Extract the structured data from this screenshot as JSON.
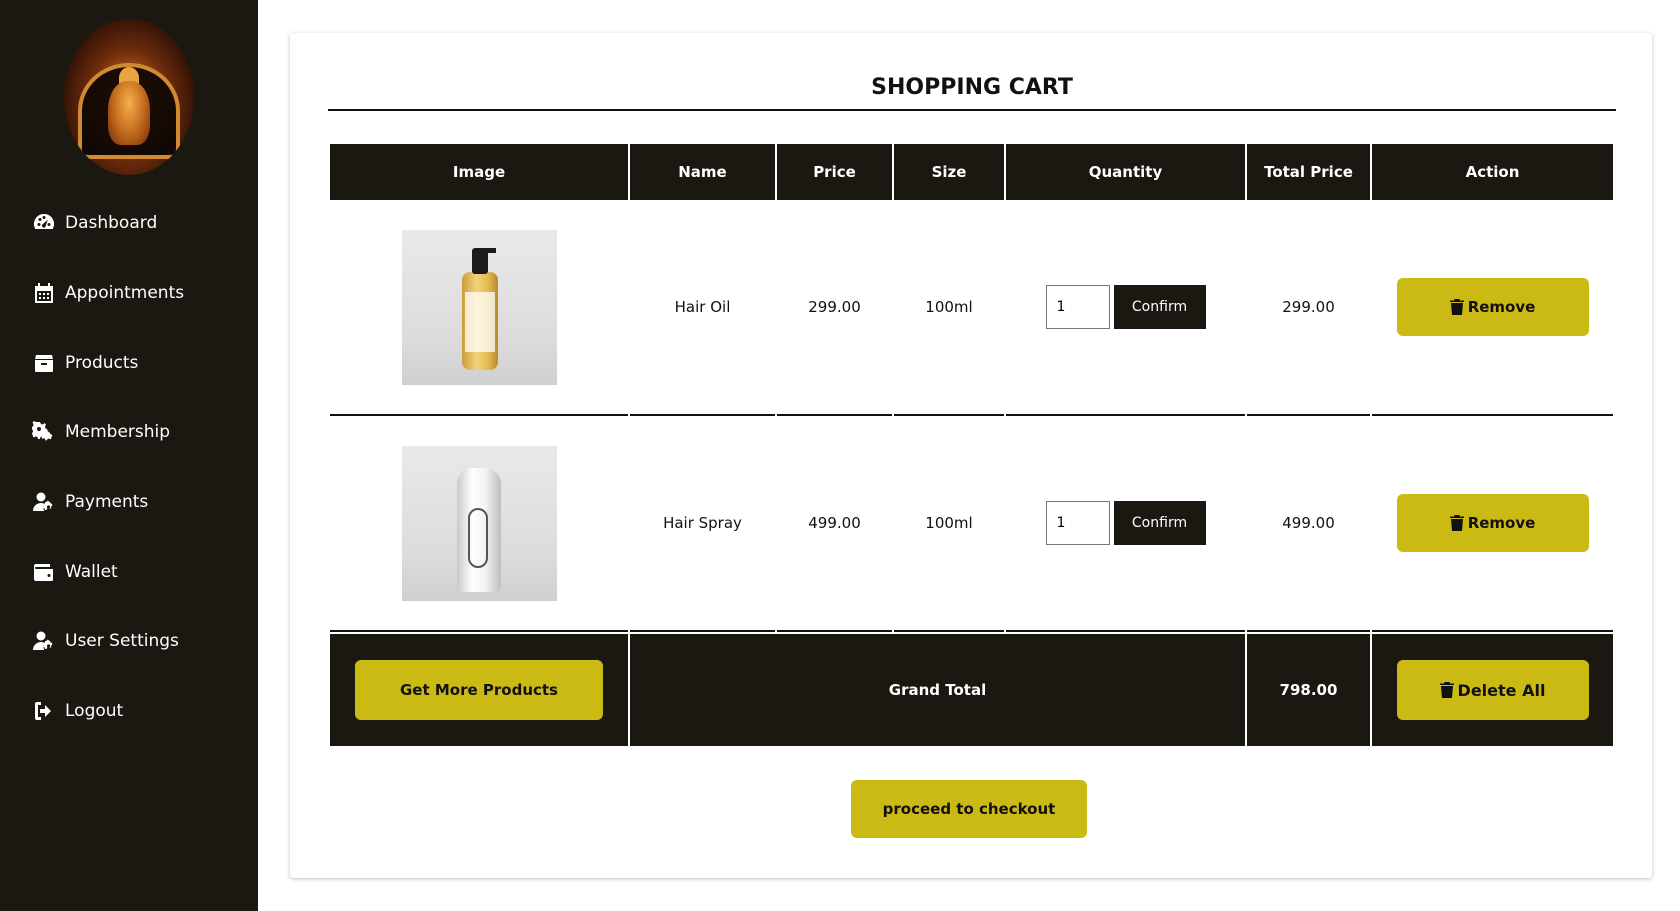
{
  "sidebar": {
    "items": [
      {
        "label": "Dashboard",
        "icon": "dashboard-icon"
      },
      {
        "label": "Appointments",
        "icon": "calendar-icon"
      },
      {
        "label": "Products",
        "icon": "box-icon"
      },
      {
        "label": "Membership",
        "icon": "gears-icon"
      },
      {
        "label": "Payments",
        "icon": "user-gear-icon"
      },
      {
        "label": "Wallet",
        "icon": "wallet-icon"
      },
      {
        "label": "User Settings",
        "icon": "user-gear-icon"
      },
      {
        "label": "Logout",
        "icon": "logout-icon"
      }
    ]
  },
  "cart": {
    "title": "SHOPPING CART",
    "headers": [
      "Image",
      "Name",
      "Price",
      "Size",
      "Quantity",
      "Total Price",
      "Action"
    ],
    "items": [
      {
        "name": "Hair Oil",
        "price": "299.00",
        "size": "100ml",
        "quantity": "1",
        "total": "299.00",
        "confirm_label": "Confirm",
        "remove_label": "Remove",
        "image": "hair-oil-bottle"
      },
      {
        "name": "Hair Spray",
        "price": "499.00",
        "size": "100ml",
        "quantity": "1",
        "total": "499.00",
        "confirm_label": "Confirm",
        "remove_label": "Remove",
        "image": "hair-spray-can"
      }
    ],
    "get_more_label": "Get More Products",
    "grand_total_label": "Grand Total",
    "grand_total": "798.00",
    "delete_all_label": "Delete All",
    "checkout_label": "proceed to checkout"
  },
  "colors": {
    "sidebar_bg": "#1b1711",
    "accent_yellow": "#cbba14",
    "header_bg": "#1b1711"
  }
}
